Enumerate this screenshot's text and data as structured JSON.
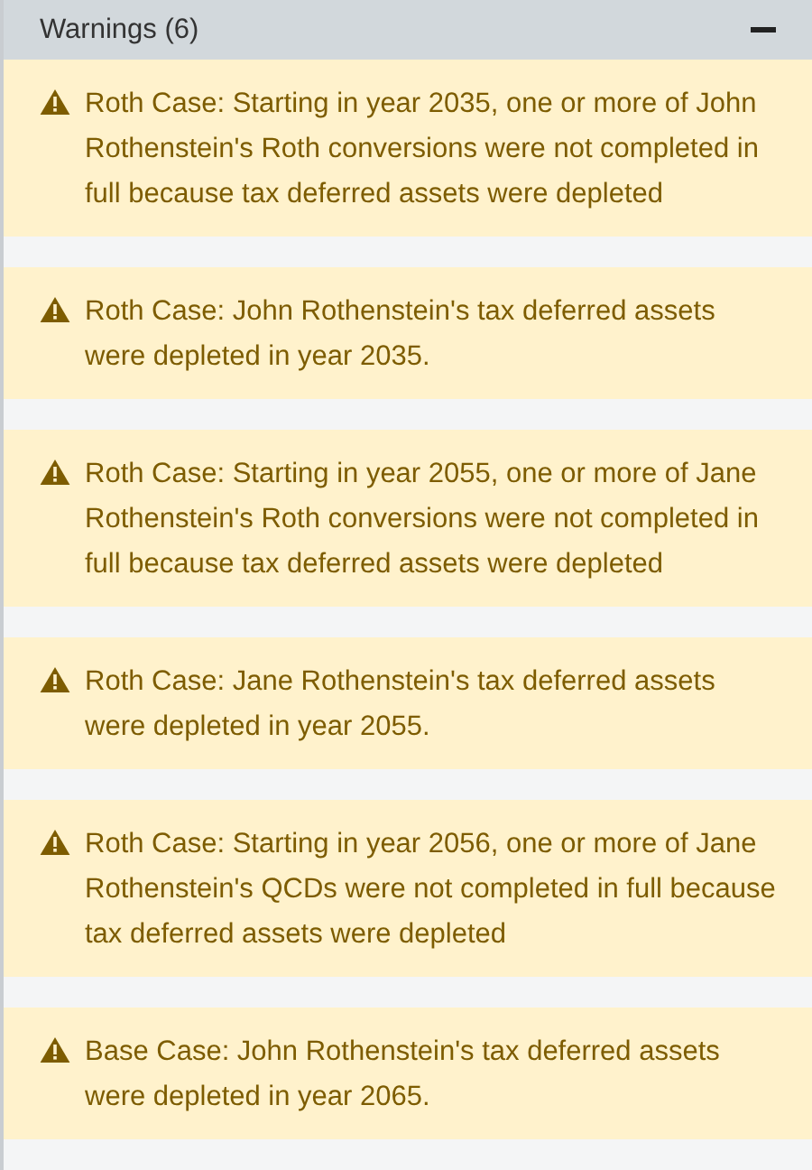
{
  "panel": {
    "title": "Warnings (6)",
    "expanded": true
  },
  "warnings": [
    {
      "text": "Roth Case: Starting in year 2035, one or more of John Rothenstein's Roth conversions were not completed in full because tax deferred assets were depleted"
    },
    {
      "text": "Roth Case: John Rothenstein's tax deferred assets were depleted in year 2035."
    },
    {
      "text": "Roth Case: Starting in year 2055, one or more of Jane Rothenstein's Roth conversions were not completed in full because tax deferred assets were depleted"
    },
    {
      "text": "Roth Case: Jane Rothenstein's tax deferred assets were depleted in year 2055."
    },
    {
      "text": "Roth Case: Starting in year 2056, one or more of Jane Rothenstein's QCDs were not completed in full because tax deferred assets were depleted"
    },
    {
      "text": "Base Case: John Rothenstein's tax deferred assets were depleted in year 2065."
    }
  ]
}
